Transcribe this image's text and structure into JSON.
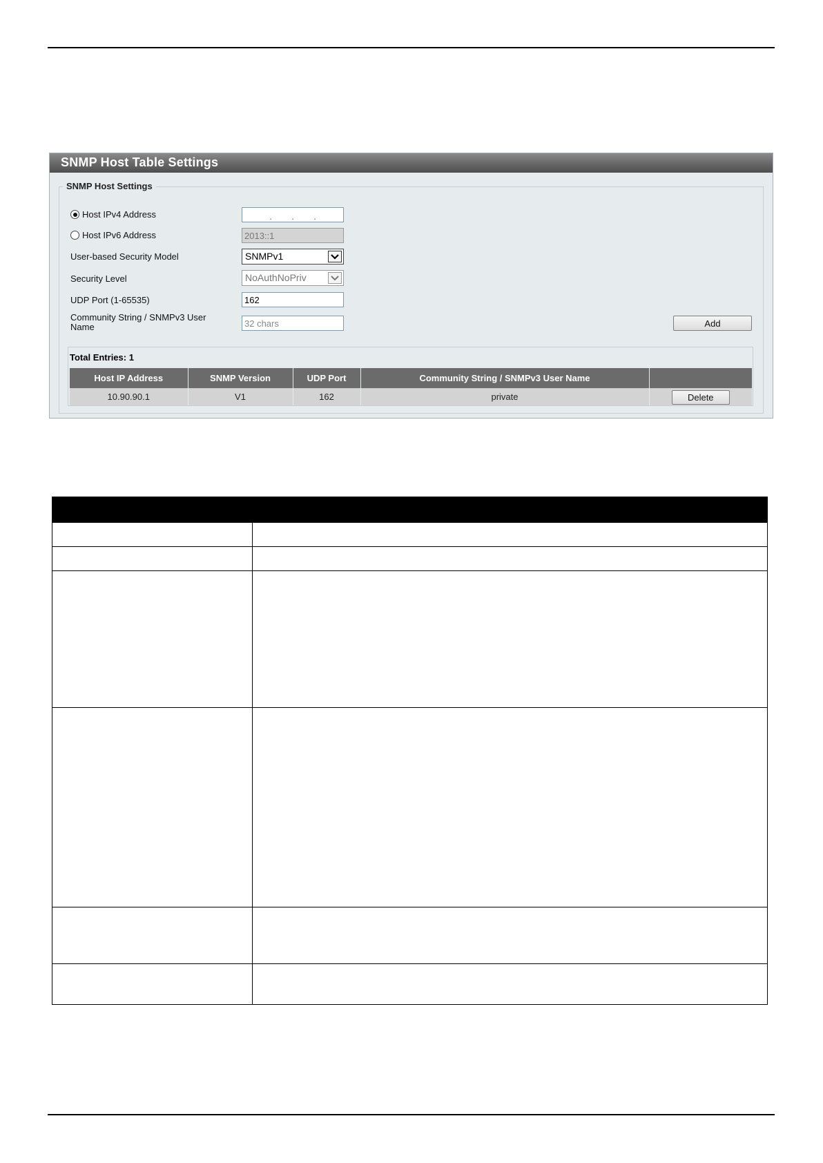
{
  "panel": {
    "title": "SNMP Host Table Settings",
    "group_legend": "SNMP Host Settings",
    "form": {
      "ipv4": {
        "label": "Host IPv4 Address",
        "selected": true,
        "separator": "."
      },
      "ipv6": {
        "label": "Host IPv6 Address",
        "selected": false,
        "value": "2013::1"
      },
      "security_model": {
        "label": "User-based Security Model",
        "value": "SNMPv1"
      },
      "security_level": {
        "label": "Security Level",
        "value": "NoAuthNoPriv"
      },
      "udp_port": {
        "label": "UDP Port (1-65535)",
        "value": "162"
      },
      "community": {
        "label_line1": "Community String / SNMPv3 User",
        "label_line2": "Name",
        "placeholder": "32 chars"
      }
    },
    "add_button": "Add",
    "total_entries": "Total Entries: 1",
    "table": {
      "headers": [
        "Host IP Address",
        "SNMP Version",
        "UDP Port",
        "Community String / SNMPv3 User Name",
        ""
      ],
      "rows": [
        {
          "host": "10.90.90.1",
          "version": "V1",
          "port": "162",
          "community": "private",
          "action": "Delete"
        }
      ]
    }
  },
  "icons": {
    "dropdown": "chevron-down-icon",
    "radio": "radio-icon"
  }
}
